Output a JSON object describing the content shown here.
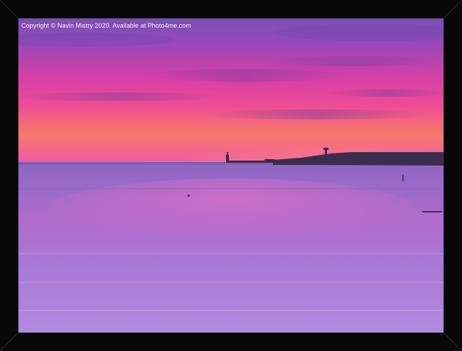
{
  "watermark": {
    "text": "Copyright © Navin Mistry 2020. Available at Photo4me.com"
  },
  "scene": {
    "subject": "sunset-seascape-with-pier-and-lighthouse",
    "colors": {
      "sky_top": "#7b4fb4",
      "sky_magenta": "#e23aa0",
      "sky_horizon_orange": "#f57a5a",
      "sea": "#a46fd0",
      "frame": "#080808"
    }
  }
}
